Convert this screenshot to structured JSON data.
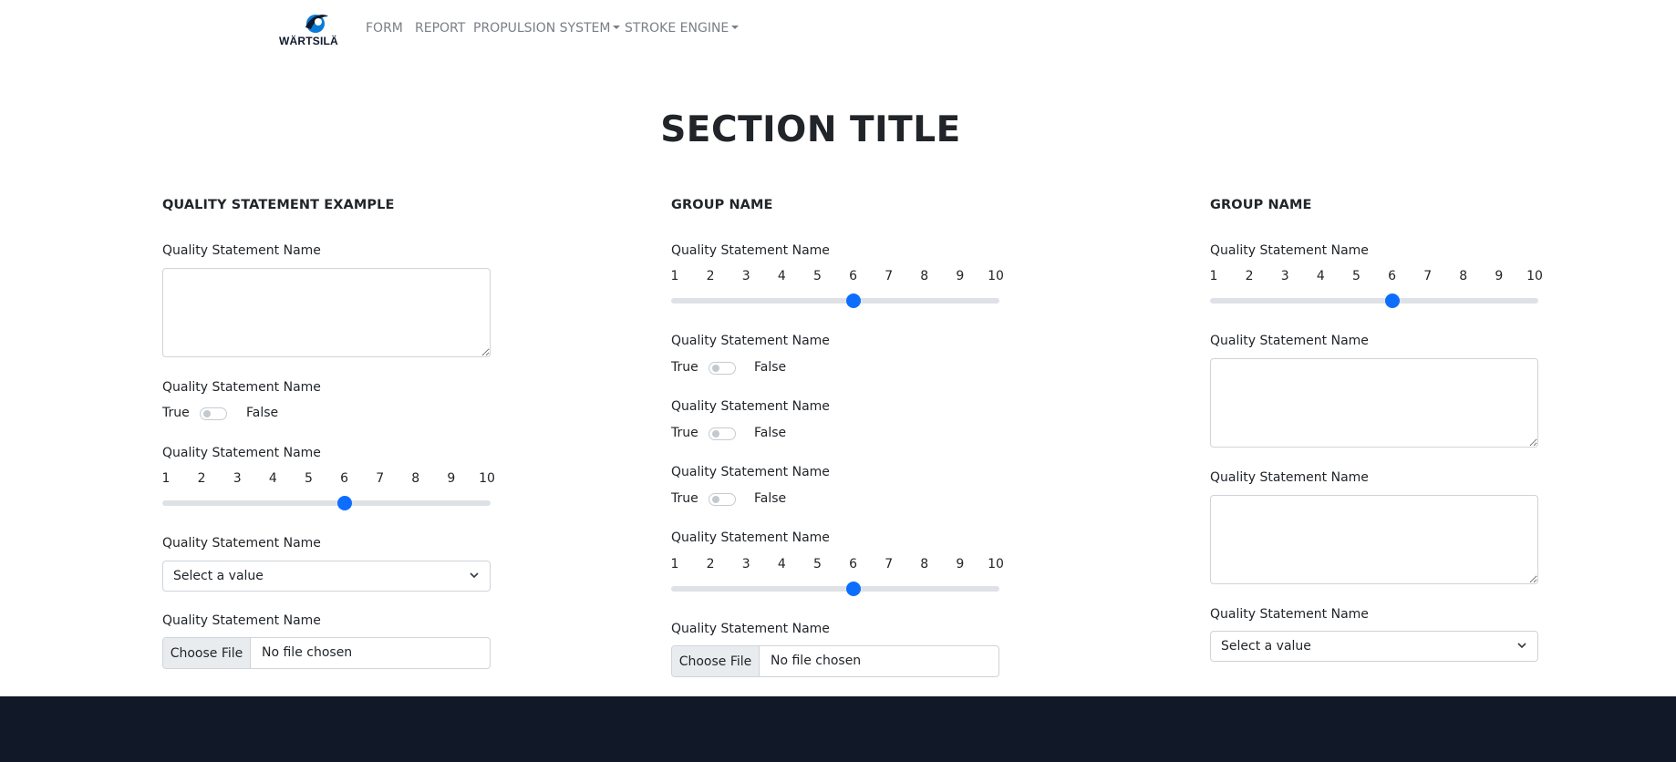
{
  "brand": {
    "name": "WÄRTSILÄ",
    "primary_color": "#0d6efd",
    "footer_color": "#111827"
  },
  "nav": {
    "items": [
      {
        "label": "FORM",
        "dropdown": false
      },
      {
        "label": "REPORT",
        "dropdown": false
      },
      {
        "label": "PROPULSION SYSTEM",
        "dropdown": true
      },
      {
        "label": "STROKE ENGINE",
        "dropdown": true
      }
    ]
  },
  "section_title": "SECTION TITLE",
  "columns": [
    {
      "title": "QUALITY STATEMENT EXAMPLE",
      "fields": [
        {
          "type": "textarea",
          "label": "Quality Statement Name",
          "value": ""
        },
        {
          "type": "toggle",
          "label": "Quality Statement Name",
          "true_label": "True",
          "false_label": "False",
          "checked": false
        },
        {
          "type": "slider",
          "label": "Quality Statement Name",
          "ticks": [
            "1",
            "2",
            "3",
            "4",
            "5",
            "6",
            "7",
            "8",
            "9",
            "10"
          ],
          "min": 1,
          "max": 10,
          "value": 6
        },
        {
          "type": "select",
          "label": "Quality Statement Name",
          "value": "Select a value"
        },
        {
          "type": "file",
          "label": "Quality Statement Name",
          "button_label": "Choose File",
          "file_text": "No file chosen"
        }
      ]
    },
    {
      "title": "GROUP NAME",
      "fields": [
        {
          "type": "slider",
          "label": "Quality Statement Name",
          "ticks": [
            "1",
            "2",
            "3",
            "4",
            "5",
            "6",
            "7",
            "8",
            "9",
            "10"
          ],
          "min": 1,
          "max": 10,
          "value": 6
        },
        {
          "type": "toggle",
          "label": "Quality Statement Name",
          "true_label": "True",
          "false_label": "False",
          "checked": false
        },
        {
          "type": "toggle",
          "label": "Quality Statement Name",
          "true_label": "True",
          "false_label": "False",
          "checked": false
        },
        {
          "type": "toggle",
          "label": "Quality Statement Name",
          "true_label": "True",
          "false_label": "False",
          "checked": false
        },
        {
          "type": "slider",
          "label": "Quality Statement Name",
          "ticks": [
            "1",
            "2",
            "3",
            "4",
            "5",
            "6",
            "7",
            "8",
            "9",
            "10"
          ],
          "min": 1,
          "max": 10,
          "value": 6
        },
        {
          "type": "file",
          "label": "Quality Statement Name",
          "button_label": "Choose File",
          "file_text": "No file chosen"
        }
      ]
    },
    {
      "title": "GROUP NAME",
      "fields": [
        {
          "type": "slider",
          "label": "Quality Statement Name",
          "ticks": [
            "1",
            "2",
            "3",
            "4",
            "5",
            "6",
            "7",
            "8",
            "9",
            "10"
          ],
          "min": 1,
          "max": 10,
          "value": 6
        },
        {
          "type": "textarea",
          "label": "Quality Statement Name",
          "value": ""
        },
        {
          "type": "textarea",
          "label": "Quality Statement Name",
          "value": ""
        },
        {
          "type": "select",
          "label": "Quality Statement Name",
          "value": "Select a value"
        }
      ]
    }
  ]
}
